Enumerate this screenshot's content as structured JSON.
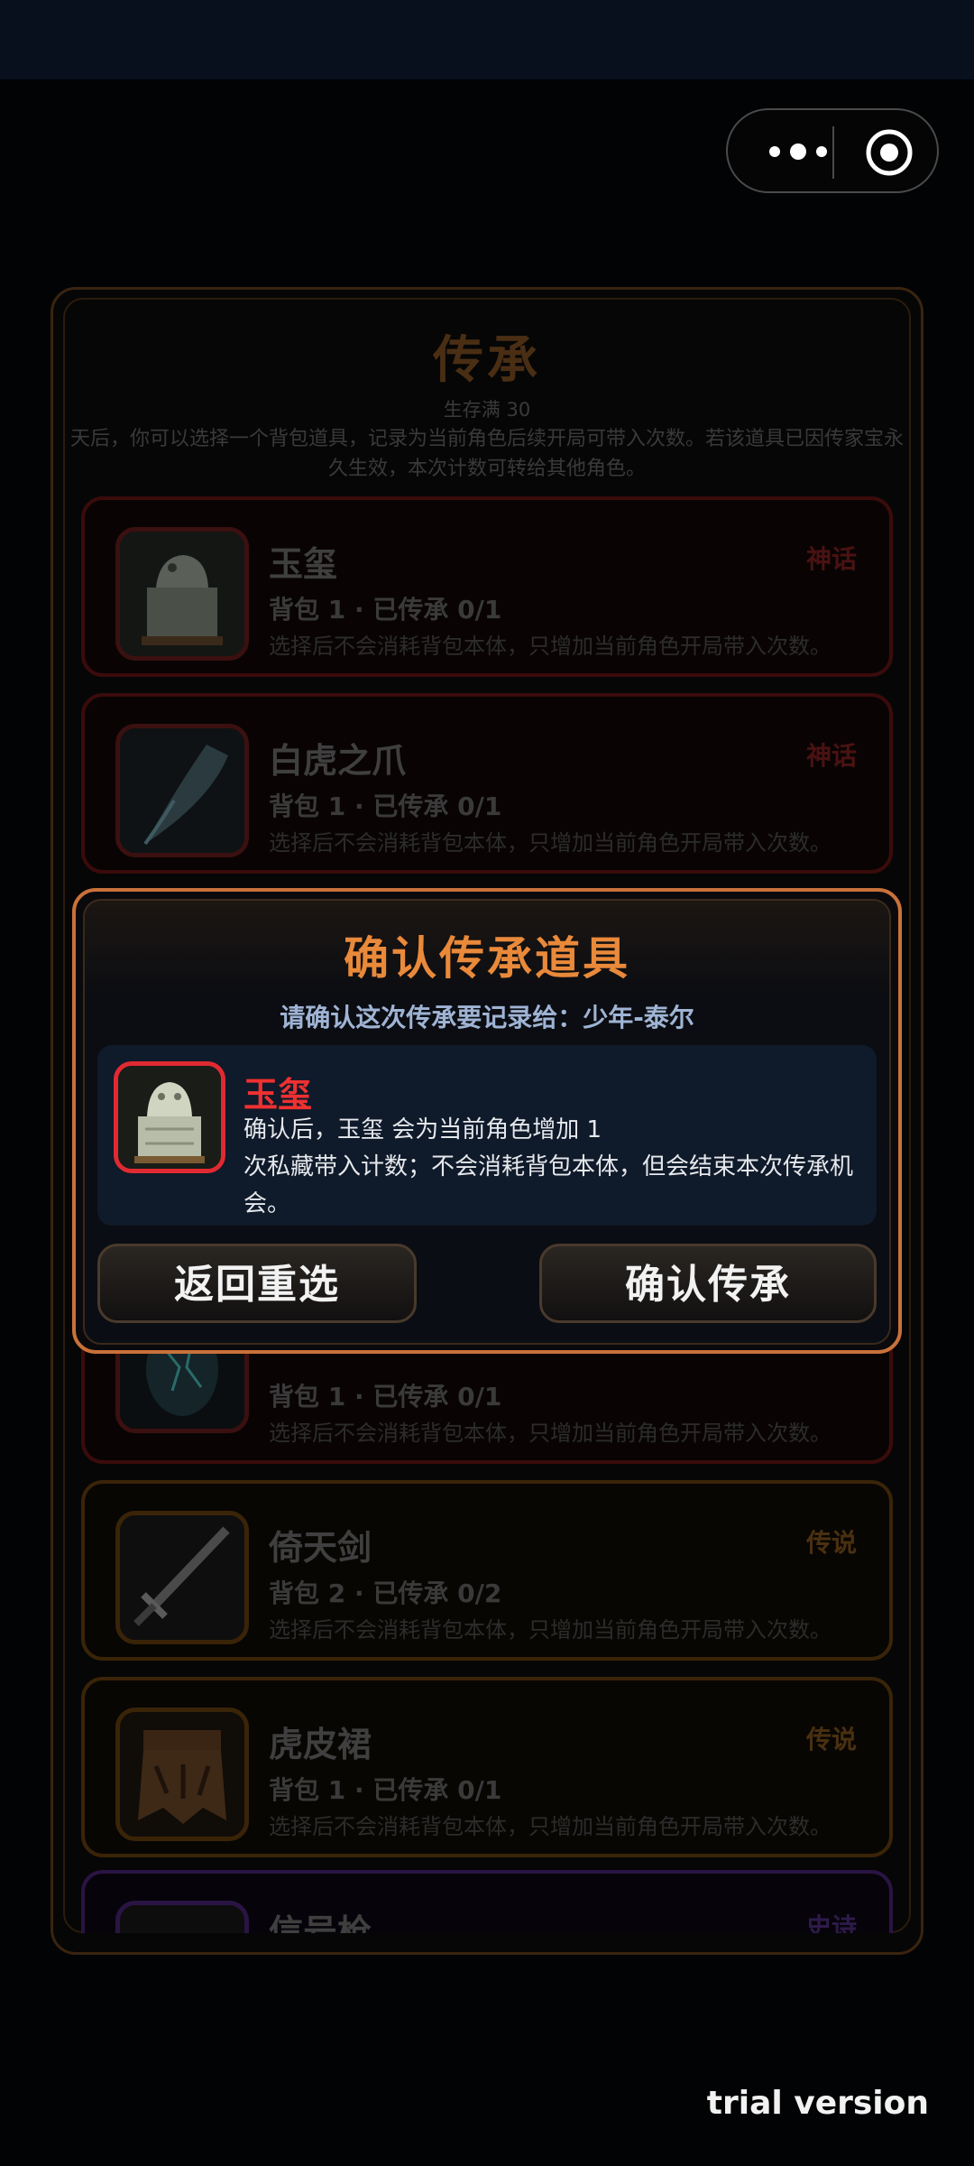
{
  "header": {
    "menu_icon": "more-dots-icon",
    "close_icon": "target-circle-icon"
  },
  "panel": {
    "title": "传承",
    "subtitle": "生存满 30",
    "description": "天后，你可以选择一个背包道具，记录为当前角色后续开局可带入次数。若该道具已因传家宝永久生效，本次计数可转给其他角色。"
  },
  "items": [
    {
      "name": "玉玺",
      "stat": "背包 1 · 已传承 0/1",
      "note": "选择后不会消耗背包本体，只增加当前角色开局带入次数。",
      "rarity": "神话"
    },
    {
      "name": "白虎之爪",
      "stat": "背包 1 · 已传承 0/1",
      "note": "选择后不会消耗背包本体，只增加当前角色开局带入次数。",
      "rarity": "神话"
    },
    {
      "name": "",
      "stat": "背包 1 · 已传承 0/1",
      "note": "选择后不会消耗背包本体，只增加当前角色开局带入次数。",
      "rarity": ""
    },
    {
      "name": "倚天剑",
      "stat": "背包 2 · 已传承 0/2",
      "note": "选择后不会消耗背包本体，只增加当前角色开局带入次数。",
      "rarity": "传说"
    },
    {
      "name": "虎皮裙",
      "stat": "背包 1 · 已传承 0/1",
      "note": "选择后不会消耗背包本体，只增加当前角色开局带入次数。",
      "rarity": "传说"
    },
    {
      "name": "信号枪",
      "rarity": "史诗"
    }
  ],
  "modal": {
    "title": "确认传承道具",
    "subtitle": "请确认这次传承要记录给：少年-泰尔",
    "item_name": "玉玺",
    "item_text": "确认后，玉玺 会为当前角色增加 1\n次私藏带入计数；不会消耗背包本体，但会结束本次传承机会。",
    "back_label": "返回重选",
    "confirm_label": "确认传承"
  },
  "watermark": "trial version",
  "colors": {
    "accent": "#e9893a",
    "mythic": "#ee3131",
    "background": "#020304"
  }
}
